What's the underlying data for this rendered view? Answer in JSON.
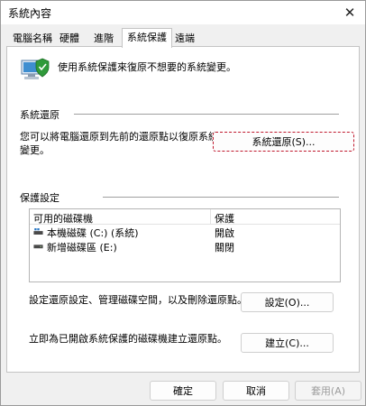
{
  "window": {
    "title": "系統內容"
  },
  "icons": {
    "close": "close-icon",
    "intro": "computer-shield-icon",
    "fixed_drive": "windows-drive-icon",
    "removable_drive": "drive-icon"
  },
  "tabs": [
    {
      "label": "電腦名稱",
      "active": false
    },
    {
      "label": "硬體",
      "active": false
    },
    {
      "label": "進階",
      "active": false
    },
    {
      "label": "系統保護",
      "active": true
    },
    {
      "label": "遠端",
      "active": false
    }
  ],
  "intro": {
    "text": "使用系統保護來復原不想要的系統變更。"
  },
  "system_restore": {
    "group_label": "系統還原",
    "description_line1": "您可以將電腦還原到先前的還原點以復原系統",
    "description_line2": "變更。",
    "button_label": "系統還原(S)..."
  },
  "protection": {
    "group_label": "保護設定",
    "columns": [
      "可用的磁碟機",
      "保護"
    ],
    "rows": [
      {
        "drive": "本機磁碟 (C:) (系統)",
        "status": "開啟"
      },
      {
        "drive": "新增磁碟區 (E:)",
        "status": "關閉"
      }
    ],
    "configure_text": "設定還原設定、管理磁碟空間，以及刪除還原點。",
    "configure_button": "設定(O)...",
    "create_text": "立即為已開啟系統保護的磁碟機建立還原點。",
    "create_button": "建立(C)..."
  },
  "footer": {
    "ok": "確定",
    "cancel": "取消",
    "apply": "套用(A)"
  },
  "colors": {
    "focus_border": "#c0182d",
    "drive_blue": "#2b78c4"
  }
}
